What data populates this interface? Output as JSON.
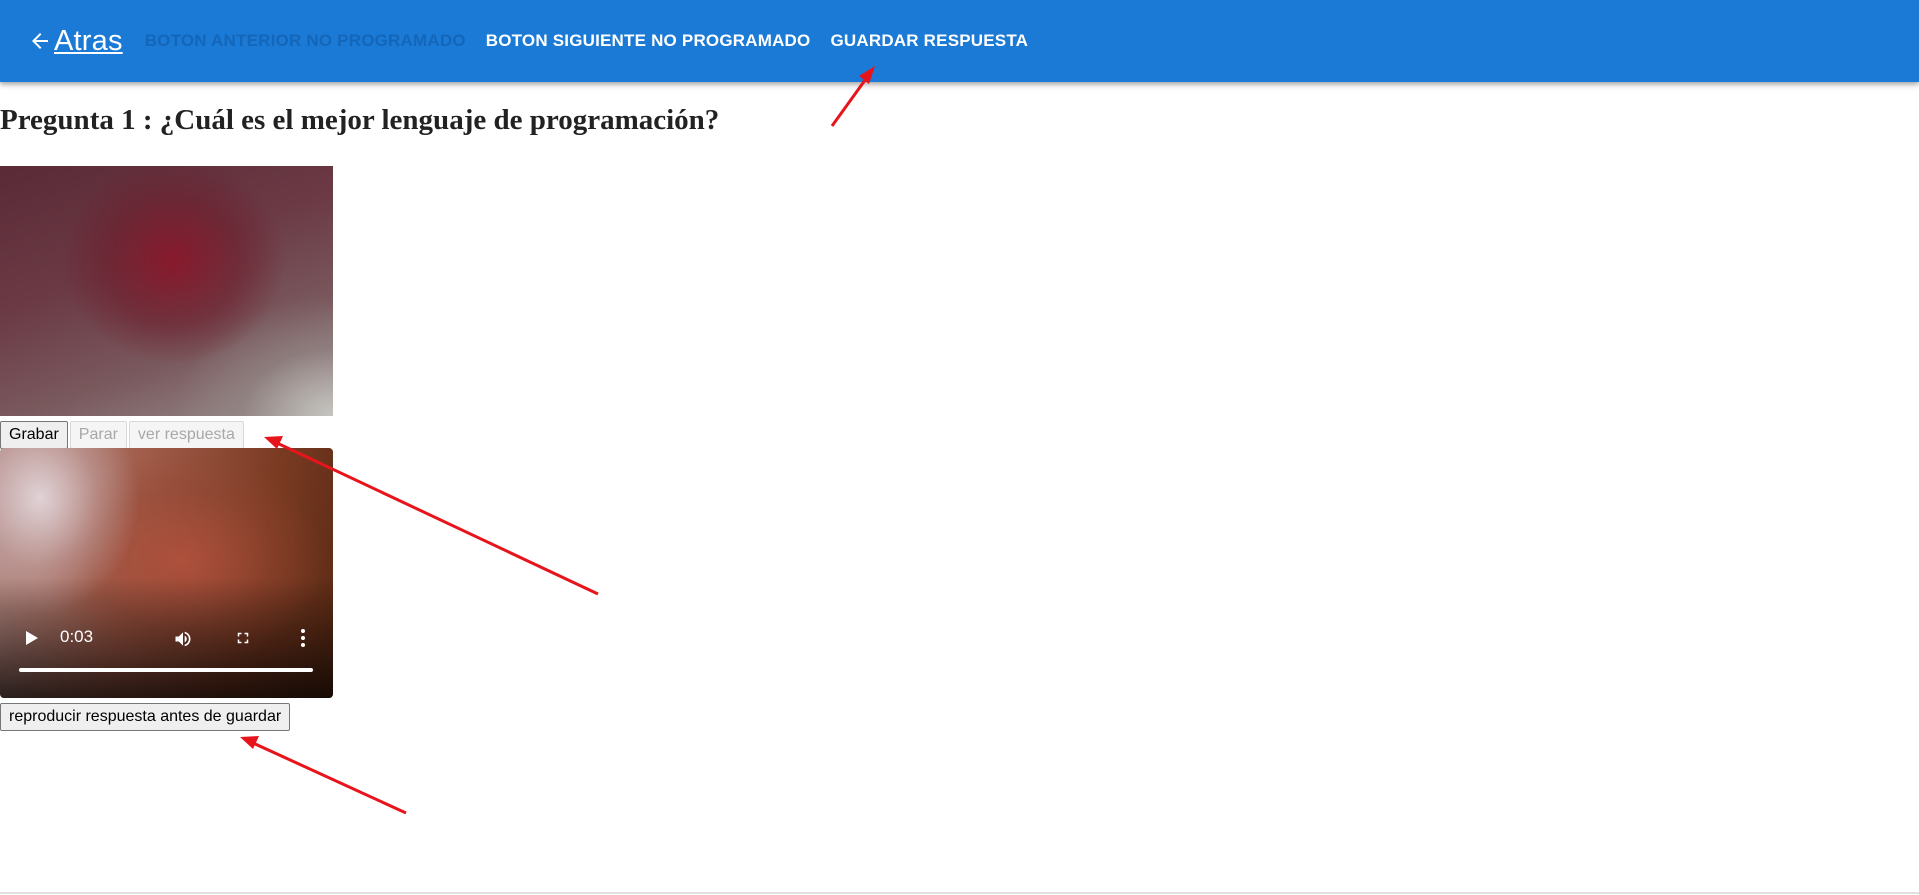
{
  "appbar": {
    "back_label": "Atras",
    "prev_button": "BOTON ANTERIOR NO PROGRAMADO",
    "next_button": "BOTON SIGUIENTE NO PROGRAMADO",
    "save_button": "GUARDAR RESPUESTA",
    "background": "#1b7ad6"
  },
  "question": {
    "text": "Pregunta 1 : ¿Cuál es el mejor lenguaje de programación?"
  },
  "recorder": {
    "record_button": "Grabar",
    "stop_button": "Parar",
    "view_button": "ver respuesta"
  },
  "player": {
    "time": "0:03",
    "progress_percent": 100
  },
  "play_answer_button": "reproducir respuesta antes de guardar",
  "annotations": {
    "arrow_color": "#e8141c"
  }
}
